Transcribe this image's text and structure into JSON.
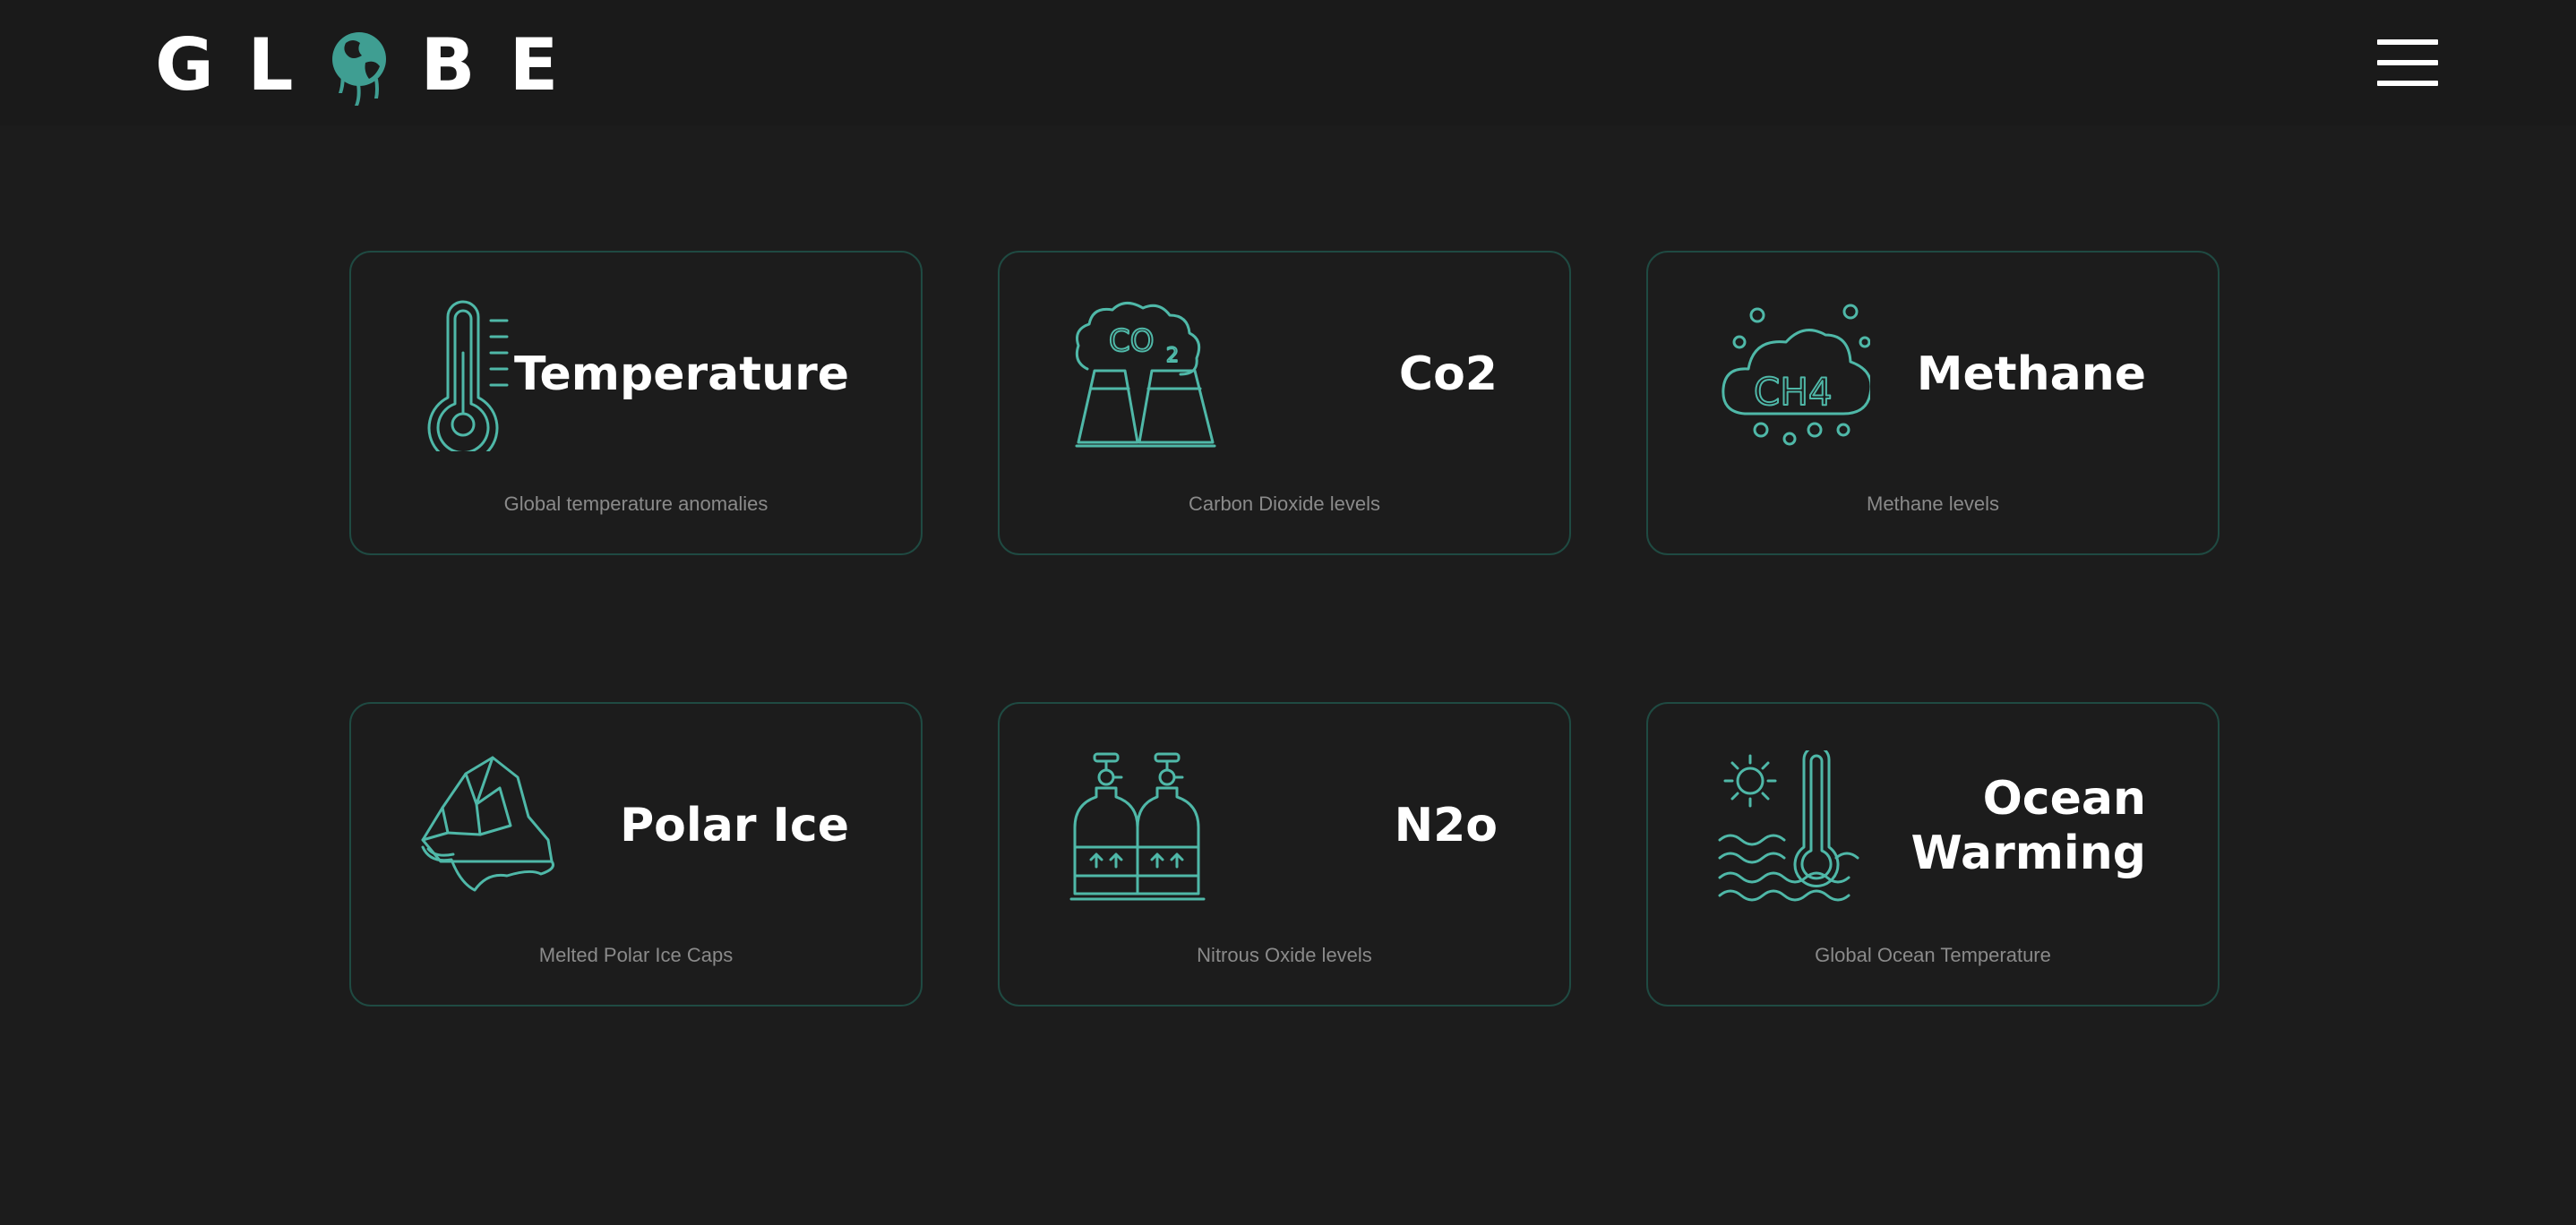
{
  "header": {
    "logo_letters": [
      "G",
      "L",
      "B",
      "E"
    ],
    "logo_text": "GLOBE",
    "menu_icon": "hamburger-icon"
  },
  "cards": [
    {
      "title": "Temperature",
      "description": "Global temperature anomalies",
      "icon": "thermometer-icon"
    },
    {
      "title": "Co2",
      "description": "Carbon Dioxide levels",
      "icon": "co2-factory-icon"
    },
    {
      "title": "Methane",
      "description": "Methane levels",
      "icon": "ch4-cloud-icon"
    },
    {
      "title": "Polar Ice",
      "description": "Melted Polar Ice Caps",
      "icon": "iceberg-icon"
    },
    {
      "title": "N2o",
      "description": "Nitrous Oxide levels",
      "icon": "gas-cylinders-icon"
    },
    {
      "title": "Ocean Warming",
      "description": "Global Ocean Temperature",
      "icon": "ocean-thermometer-icon"
    }
  ],
  "colors": {
    "background": "#1c1c1c",
    "header_background": "#1a1a1a",
    "accent": "#4fb8a8",
    "card_border": "#1f4a42",
    "text": "#ffffff",
    "muted_text": "#8a8a8a"
  }
}
